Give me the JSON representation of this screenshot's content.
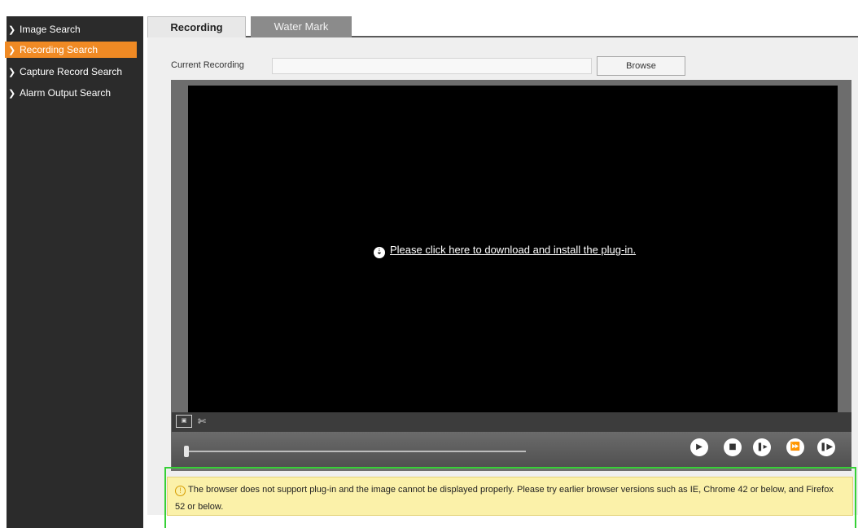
{
  "sidebar": {
    "items": [
      {
        "label": "Image Search",
        "icon": "chevron-right-icon",
        "active": false
      },
      {
        "label": "Recording Search",
        "icon": "chevron-right-icon",
        "active": true
      },
      {
        "label": "Capture Record Search",
        "icon": "chevron-right-icon",
        "active": false
      },
      {
        "label": "Alarm Output Search",
        "icon": "chevron-right-icon",
        "active": false
      }
    ]
  },
  "tabs": [
    {
      "label": "Recording",
      "active": true
    },
    {
      "label": "Water Mark",
      "active": false
    }
  ],
  "recording": {
    "current_label": "Current Recording",
    "current_value": "",
    "browse_label": "Browse"
  },
  "player": {
    "plugin_message": "Please click here to download and install the plug-in.",
    "plugin_icon": "download-circle-icon",
    "tools": [
      "fit-screen-icon",
      "crop-tool-icon"
    ],
    "progress": 0,
    "controls": [
      "play-icon",
      "stop-icon",
      "step-forward-icon",
      "fast-forward-icon",
      "frame-next-icon"
    ]
  },
  "warning": {
    "icon": "warning-icon",
    "text": "The browser does not support plug-in and the image cannot be displayed properly. Please try earlier browser versions such as IE, Chrome 42 or below, and Firefox 52 or below."
  },
  "colors": {
    "sidebar_bg": "#2b2b2b",
    "active_item": "#f08a24",
    "warning_bg": "#fbf1a9",
    "highlight": "#36d036"
  }
}
